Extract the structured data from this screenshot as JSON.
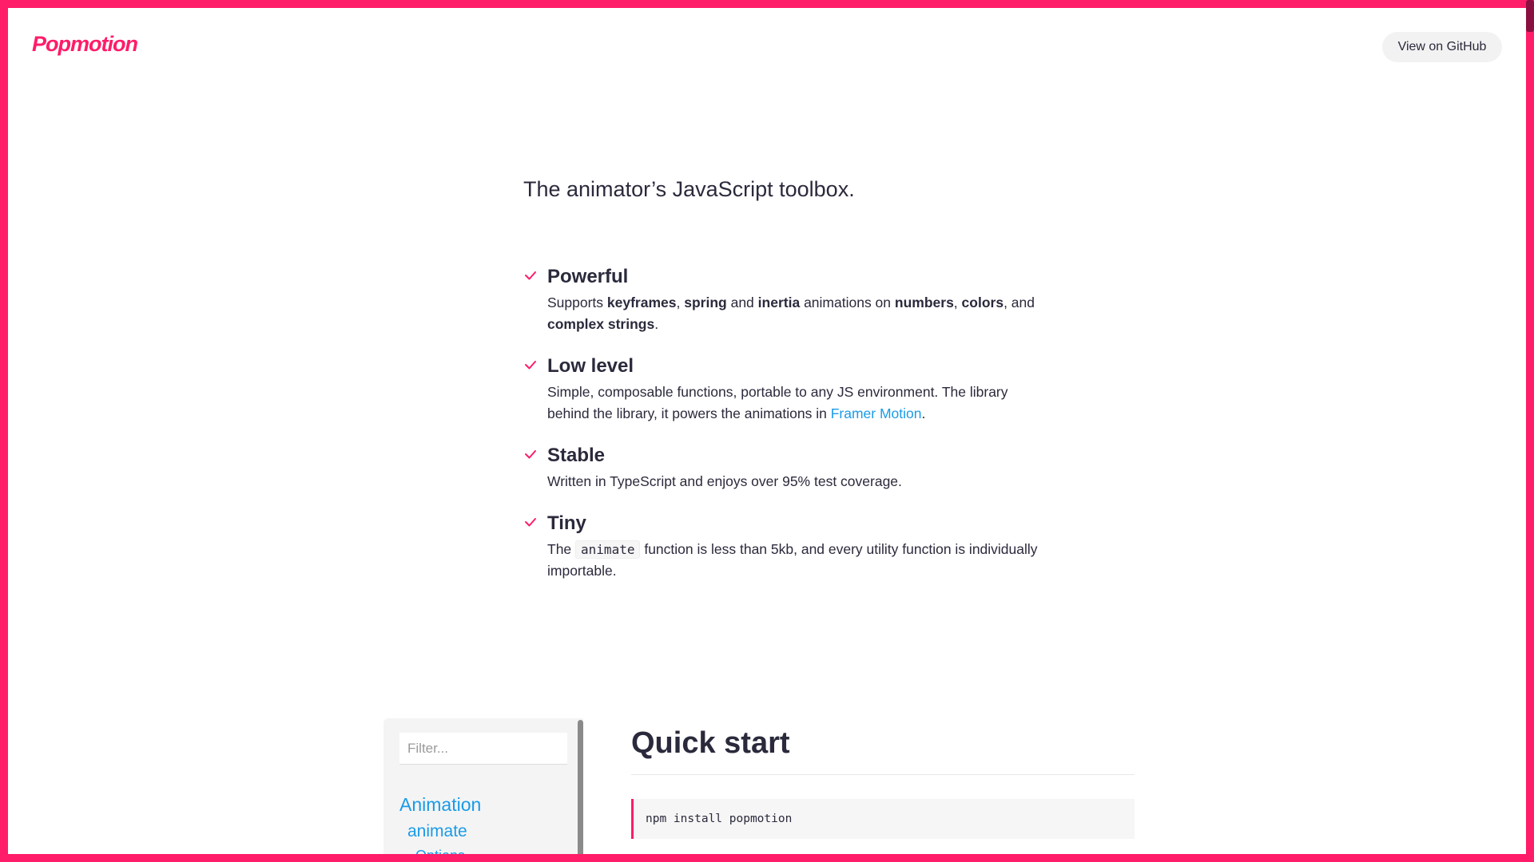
{
  "header": {
    "logo": "Popmotion",
    "github_button": "View on GitHub"
  },
  "hero": {
    "tagline": "The animator’s JavaScript toolbox."
  },
  "features": [
    {
      "title": "Powerful",
      "parts": [
        "Supports ",
        "keyframes",
        ", ",
        "spring",
        " and ",
        "inertia",
        " animations on ",
        "numbers",
        ", ",
        "colors",
        ", and ",
        "complex strings",
        "."
      ]
    },
    {
      "title": "Low level",
      "text_before": "Simple, composable functions, portable to any JS environment. The library behind the library, it powers the animations in ",
      "link": "Framer Motion",
      "text_after": "."
    },
    {
      "title": "Stable",
      "text": "Written in TypeScript and enjoys over 95% test coverage."
    },
    {
      "title": "Tiny",
      "text_before": "The ",
      "code": "animate",
      "text_after": " function is less than 5kb, and every utility function is individually importable."
    }
  ],
  "sidebar": {
    "filter_placeholder": "Filter...",
    "section": "Animation",
    "item": "animate",
    "subitem": "Options"
  },
  "quickstart": {
    "title": "Quick start",
    "code": "npm install popmotion"
  },
  "colors": {
    "brand": "#ff1c68",
    "link": "#1a9be6",
    "text": "#2a2a3c"
  },
  "icons": {
    "feature_bullet": "checkmark-icon"
  }
}
